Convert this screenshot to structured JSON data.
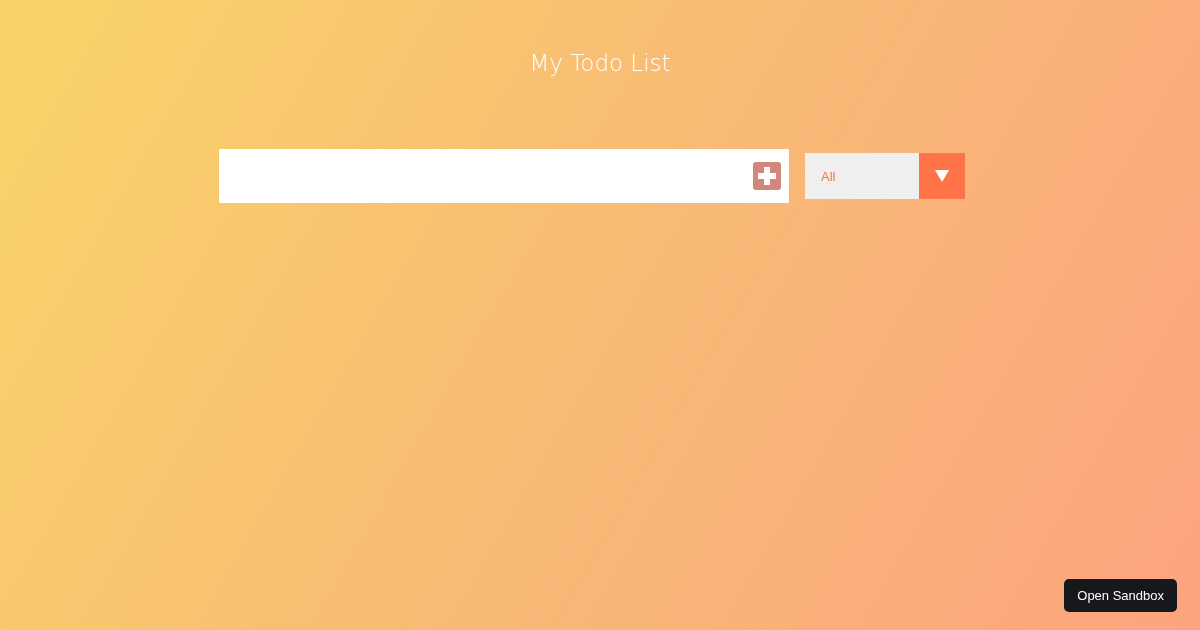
{
  "title": "My Todo List",
  "filter": {
    "value": "All"
  },
  "sandbox_button": {
    "label": "Open Sandbox"
  }
}
